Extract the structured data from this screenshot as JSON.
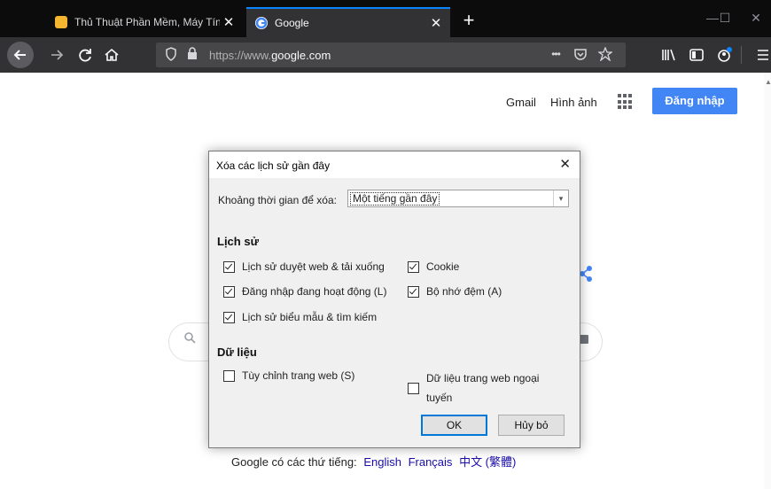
{
  "browser": {
    "tabs": [
      {
        "title": "Thủ Thuật Phần Mềm, Máy Tính",
        "close": "✕",
        "favicon_color": "#f5b52e"
      },
      {
        "title": "Google",
        "close": "✕",
        "favicon_color": "#4285f4"
      }
    ],
    "new_tab": "+",
    "window": {
      "minimize": "—",
      "maximize": "☐",
      "close": "✕"
    },
    "url": {
      "prefix": "https://www.",
      "domain": "google.com"
    },
    "url_actions": "•••"
  },
  "google": {
    "gmail": "Gmail",
    "images": "Hình ảnh",
    "sign_in": "Đăng nhập",
    "offered_in": "Google có các thứ tiếng:",
    "languages": [
      "English",
      "Français",
      "中文 (繁體)"
    ]
  },
  "dialog": {
    "title": "Xóa các lịch sử gần đây",
    "close": "✕",
    "range_label": "Khoảng thời gian để xóa:",
    "range_value": "Một tiếng gần đây",
    "history_heading": "Lịch sử",
    "history_items": [
      {
        "label": "Lịch sử duyệt web & tải xuống",
        "checked": true
      },
      {
        "label": "Đăng nhập đang hoạt động (L)",
        "checked": true
      },
      {
        "label": "Lịch sử biểu mẫu & tìm kiếm",
        "checked": true
      },
      {
        "label": "Cookie",
        "checked": true
      },
      {
        "label": "Bộ nhớ đệm (A)",
        "checked": true
      }
    ],
    "data_heading": "Dữ liệu",
    "data_items": [
      {
        "label": "Tùy chỉnh trang web (S)",
        "checked": false
      },
      {
        "label_line1": "Dữ liệu trang web ngoại",
        "label_line2": "tuyến",
        "checked": false
      }
    ],
    "ok": "OK",
    "cancel": "Hủy bỏ"
  }
}
